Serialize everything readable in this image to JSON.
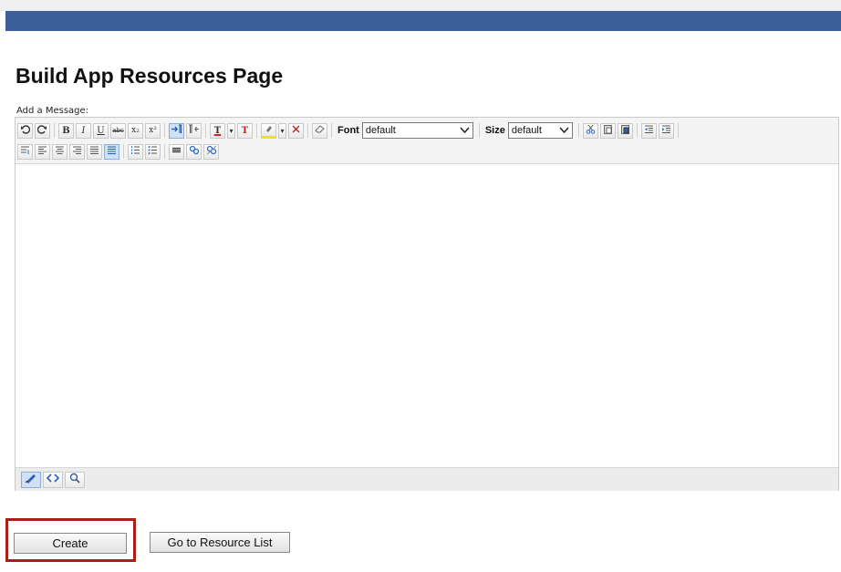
{
  "page": {
    "title": "Build App Resources Page",
    "editor_label": "Add a Message:"
  },
  "toolbar": {
    "bold": "B",
    "italic": "I",
    "underline": "U",
    "strikethrough": "abc",
    "subscript": "x₂",
    "superscript": "x²",
    "font_label": "Font",
    "font_value": "default",
    "size_label": "Size",
    "size_value": "default"
  },
  "icons": {
    "undo": "undo-icon",
    "redo": "redo-icon",
    "ltr": "ltr-icon",
    "rtl": "rtl-icon",
    "text_color": "text-color-icon",
    "remove_text_color": "remove-text-color-icon",
    "highlight": "highlight-color-icon",
    "remove_highlight": "remove-highlight-icon",
    "eraser": "eraser-icon",
    "cut": "cut-icon",
    "paste": "paste-icon",
    "paste_word": "paste-from-word-icon",
    "outdent": "outdent-icon",
    "indent": "indent-icon",
    "align_left": "align-left-icon",
    "align_center": "align-center-icon",
    "align_right": "align-right-icon",
    "justify": "justify-icon",
    "numbered_list": "numbered-list-icon",
    "bulleted_list": "bulleted-list-icon",
    "horizontal_rule": "horizontal-rule-icon",
    "link": "link-icon",
    "unlink": "unlink-icon",
    "design_mode": "pencil-icon",
    "html_mode": "html-code-icon",
    "preview_mode": "magnifier-icon"
  },
  "colors": {
    "header_bar": "#3d5f99",
    "highlight_border": "#a8201a",
    "text_color_underline": "#e02020",
    "highlight_underline": "#f2e600"
  },
  "actions": {
    "create_label": "Create",
    "resource_list_label": "Go to Resource List"
  }
}
